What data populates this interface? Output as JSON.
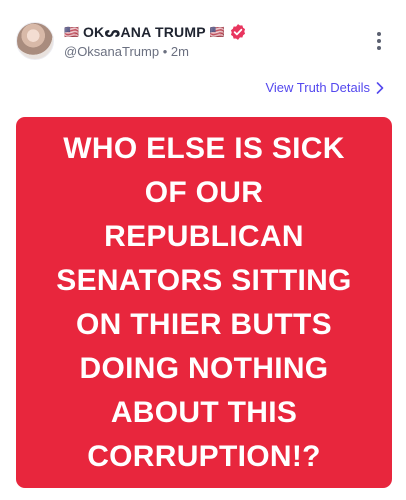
{
  "post": {
    "author": {
      "flag_left": "🇺🇸",
      "display_name": "OKᔕANA TRUMP",
      "flag_right": "🇺🇸",
      "handle": "@OksanaTrump",
      "separator": "•",
      "time": "2m",
      "verified_icon": "verified-badge-icon",
      "verified_color": "#e8355e"
    },
    "view_details_label": "View Truth Details",
    "image": {
      "background_color": "#e8263d",
      "text": "WHO ELSE IS SICK\nOF OUR\nREPUBLICAN\nSENATORS SITTING\nON THIER BUTTS\nDOING NOTHING\nABOUT THIS\nCORRUPTION!?"
    },
    "accent_color": "#5448ee"
  }
}
